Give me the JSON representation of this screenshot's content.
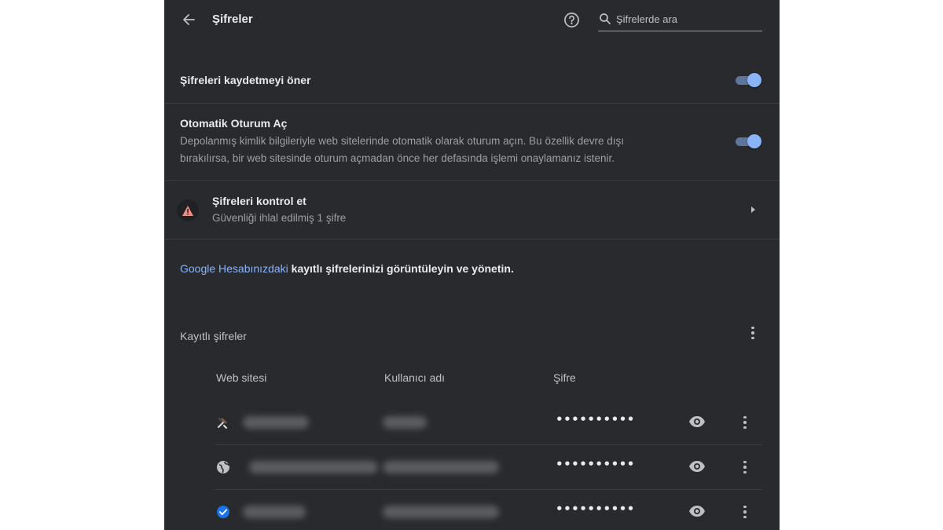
{
  "header": {
    "title": "Şifreler",
    "search_placeholder": "Şifrelerde ara"
  },
  "settings": {
    "offer_to_save": {
      "label": "Şifreleri kaydetmeyi öner",
      "enabled": true
    },
    "auto_signin": {
      "label": "Otomatik Oturum Aç",
      "desc_line1": "Depolanmış kimlik bilgileriyle web sitelerinde otomatik olarak oturum açın. Bu özellik devre dışı",
      "desc_line2": "bırakılırsa, bir web sitesinde oturum açmadan önce her defasında işlemi onaylamanız istenir.",
      "enabled": true
    },
    "check_passwords": {
      "label": "Şifreleri kontrol et",
      "desc": "Güvenliği ihlal edilmiş 1 şifre"
    }
  },
  "google_account": {
    "link_text": "Google Hesabınızdaki",
    "rest_text": " kayıtlı şifrelerinizi görüntüleyin ve yönetin."
  },
  "saved_passwords": {
    "title": "Kayıtlı şifreler",
    "columns": [
      "Web sitesi",
      "Kullanıcı adı",
      "Şifre"
    ],
    "rows": [
      {
        "site_icon": "tools-icon",
        "password_mask": "••••••••••"
      },
      {
        "site_icon": "globe-icon",
        "password_mask": "••••••••••"
      },
      {
        "site_icon": "check-circle-icon",
        "password_mask": "••••••••••"
      }
    ]
  },
  "colors": {
    "panel_bg": "#292a2d",
    "accent": "#8ab4f8",
    "warning": "#f28b82",
    "check_blue": "#1a73e8"
  }
}
